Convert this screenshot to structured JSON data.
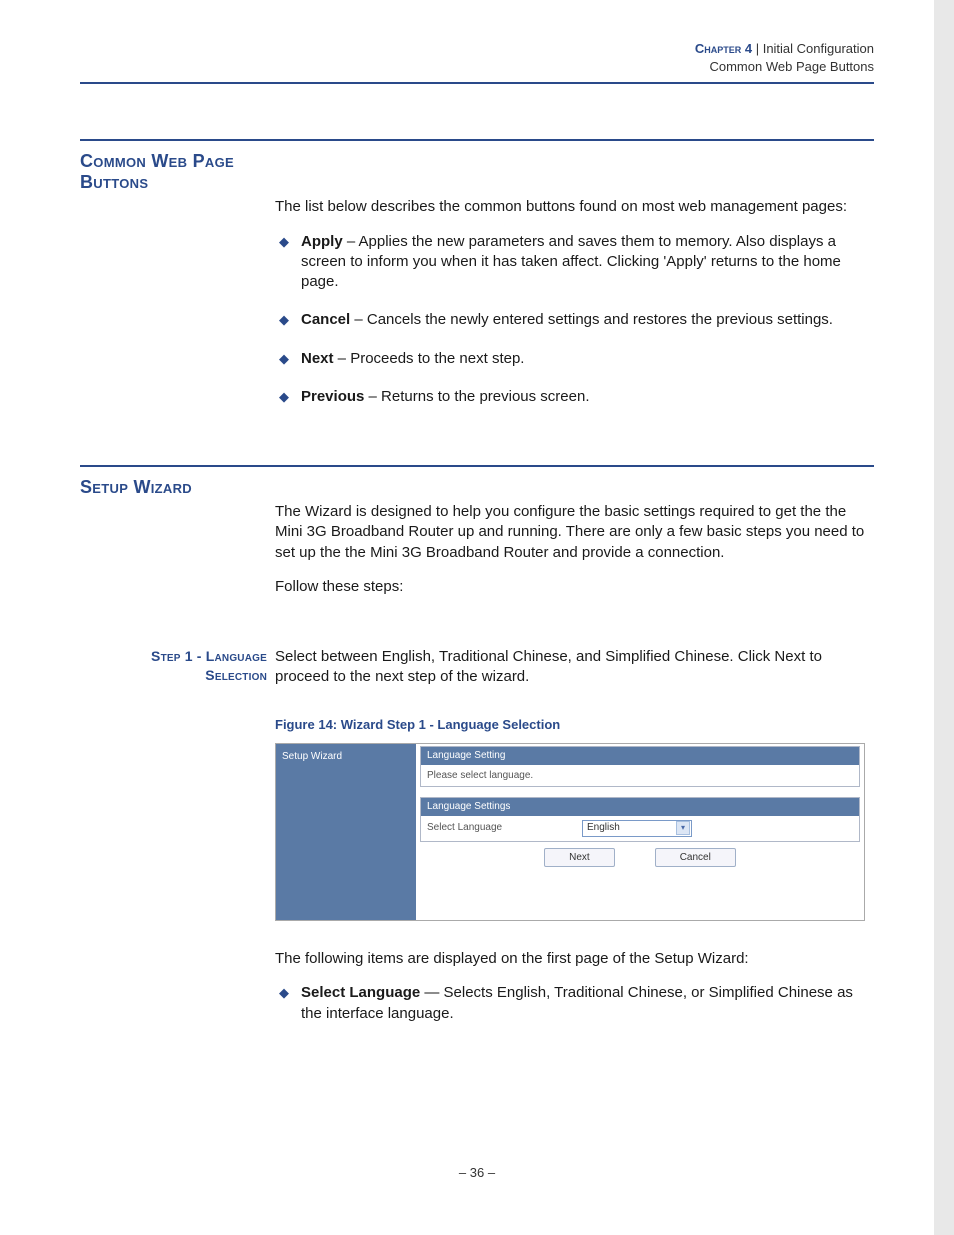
{
  "header": {
    "chapter": "Chapter 4",
    "sep": "  |  ",
    "title": "Initial Configuration",
    "subtitle": "Common Web Page Buttons"
  },
  "section1": {
    "title": "Common Web Page Buttons",
    "intro": "The list below describes the common buttons found on most web management pages:",
    "items": [
      {
        "term": "Apply",
        "desc": " – Applies the new parameters and saves them to memory. Also displays a screen to inform you when it has taken affect. Clicking 'Apply' returns to the home page."
      },
      {
        "term": "Cancel",
        "desc": " – Cancels the newly entered settings and restores the previous settings."
      },
      {
        "term": "Next",
        "desc": " – Proceeds to the next step."
      },
      {
        "term": "Previous",
        "desc": " – Returns to the previous screen."
      }
    ]
  },
  "section2": {
    "title": "Setup Wizard",
    "intro": "The Wizard is designed to help you configure the basic settings required to get the the Mini 3G Broadband Router up and running. There are only a few basic steps you need to set up the the Mini 3G Broadband Router and provide a connection.",
    "follow": "Follow these steps:"
  },
  "step1": {
    "label_line1": "Step 1 - Language",
    "label_line2": "Selection",
    "desc": "Select between English, Traditional Chinese, and Simplified Chinese. Click Next to proceed to the next step of the wizard.",
    "figure_caption": "Figure 14:  Wizard Step 1 - Language Selection"
  },
  "wizard": {
    "sidebar_item": "Setup Wizard",
    "panel1_title": "Language Setting",
    "panel1_body": "Please select language.",
    "panel2_title": "Language Settings",
    "row_label": "Select Language",
    "select_value": "English",
    "btn_next": "Next",
    "btn_cancel": "Cancel"
  },
  "after_figure": {
    "text": "The following items are displayed on the first page of the Setup Wizard:",
    "item_term": "Select Language",
    "item_desc": " — Selects English, Traditional Chinese, or Simplified Chinese as the interface language."
  },
  "page_number": "–  36  –"
}
